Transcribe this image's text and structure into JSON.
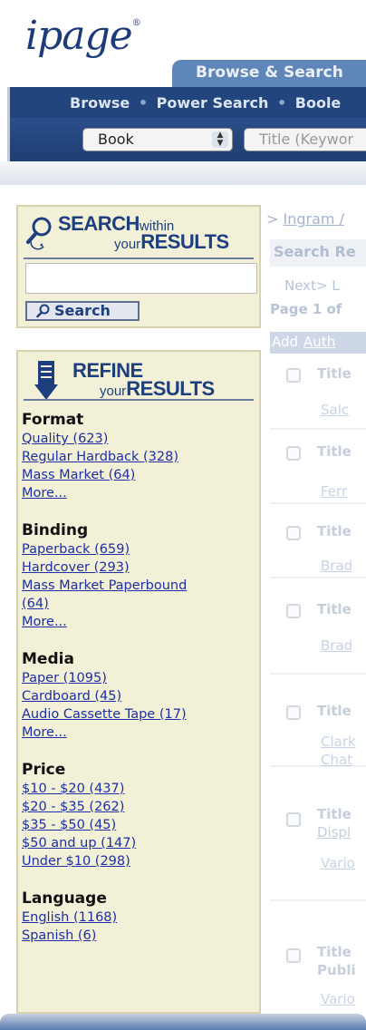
{
  "header": {
    "logo": "ipage",
    "logo_mark": "®",
    "top_tab": "Browse & Search",
    "nav_links": [
      "Browse",
      "Power Search",
      "Boole"
    ],
    "nav_sep": "•",
    "type_select": "Book",
    "keyword_select": "Title (Keywor"
  },
  "search_panel": {
    "title_big_1": "SEARCH",
    "title_small_1": "within",
    "title_small_2": "your",
    "title_big_2": "RESULTS",
    "input_value": "",
    "button_label": "Search"
  },
  "refine_panel": {
    "title_big_1": "REFINE",
    "title_small_2": "your",
    "title_big_2": "RESULTS",
    "facets": [
      {
        "title": "Format",
        "items": [
          "Quality (623)",
          "Regular Hardback (328)",
          "Mass Market (64)",
          "More..."
        ]
      },
      {
        "title": "Binding",
        "items": [
          "Paperback (659)",
          "Hardcover (293)",
          "Mass Market Paperbound",
          "(64)",
          "More..."
        ]
      },
      {
        "title": "Media",
        "items": [
          "Paper (1095)",
          "Cardboard (45)",
          "Audio Cassette Tape (17)",
          "More..."
        ]
      },
      {
        "title": "Price",
        "items": [
          "$10 - $20 (437)",
          "$20 - $35 (262)",
          "$35 - $50 (45)",
          "$50 and up (147)",
          "Under $10 (298)"
        ]
      },
      {
        "title": "Language",
        "items": [
          "English (1168)",
          "Spanish (6)"
        ]
      }
    ]
  },
  "results": {
    "breadcrumb_arrow": ">",
    "breadcrumb": "Ingram /",
    "header": "Search Re",
    "next": "Next>",
    "next_tail": "L",
    "page_of": "Page 1 of",
    "col_add": "Add",
    "col_author": "Auth",
    "rows": [
      {
        "title": "Title",
        "sub": "",
        "author": "Salc"
      },
      {
        "title": "Title",
        "sub": "",
        "author": "Ferr"
      },
      {
        "title": "Title",
        "sub": "",
        "author": "Brad"
      },
      {
        "title": "Title",
        "sub": "",
        "author": "Brad"
      },
      {
        "title": "Title",
        "sub": "",
        "author": "Clark",
        "author2": "Chat"
      },
      {
        "title": "Title",
        "sub": "Displ",
        "author": "Vario"
      },
      {
        "title": "Title",
        "sub": "Publi",
        "author": "Vario"
      }
    ]
  },
  "colors": {
    "nav_blue": "#23457e",
    "tab_blue": "#5f86b8",
    "panel_bg": "#f2f0d7",
    "link": "#1e2fa8"
  }
}
